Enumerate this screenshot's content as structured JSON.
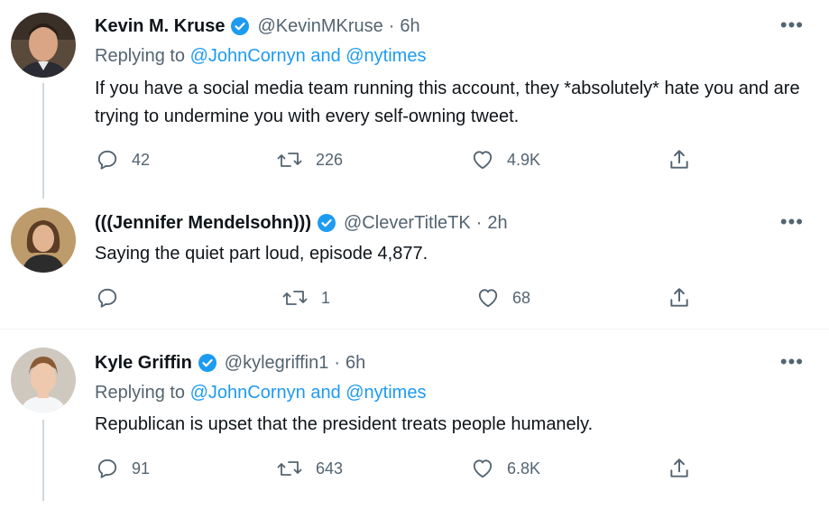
{
  "tweets": [
    {
      "name": "Kevin M. Kruse",
      "handle": "@KevinMKruse",
      "sep": "·",
      "time": "6h",
      "replying_prefix": "Replying to",
      "replying_links": "@JohnCornyn and @nytimes",
      "text": "If you have a social media team running this account, they *absolutely* hate you and are trying to undermine you with every self-owning tweet.",
      "replies": "42",
      "retweets": "226",
      "likes": "4.9K",
      "more": "•••"
    },
    {
      "name": "(((Jennifer Mendelsohn)))",
      "handle": "@CleverTitleTK",
      "sep": "·",
      "time": "2h",
      "text": "Saying the quiet part loud, episode 4,877.",
      "replies": "",
      "retweets": "1",
      "likes": "68",
      "more": "•••"
    },
    {
      "name": "Kyle Griffin",
      "handle": "@kylegriffin1",
      "sep": "·",
      "time": "6h",
      "replying_prefix": "Replying to",
      "replying_links": "@JohnCornyn and @nytimes",
      "text": "Republican is upset that the president treats people humanely.",
      "replies": "91",
      "retweets": "643",
      "likes": "6.8K",
      "more": "•••"
    }
  ],
  "icons": {
    "reply": "reply-icon",
    "retweet": "retweet-icon",
    "like": "heart-icon",
    "share": "share-icon",
    "verified": "verified-badge-icon",
    "more": "more-options-icon"
  },
  "colors": {
    "accent": "#1d9bf0",
    "secondary_text": "#536471",
    "primary_text": "#0f1419",
    "thread_line": "#cfd9de"
  }
}
